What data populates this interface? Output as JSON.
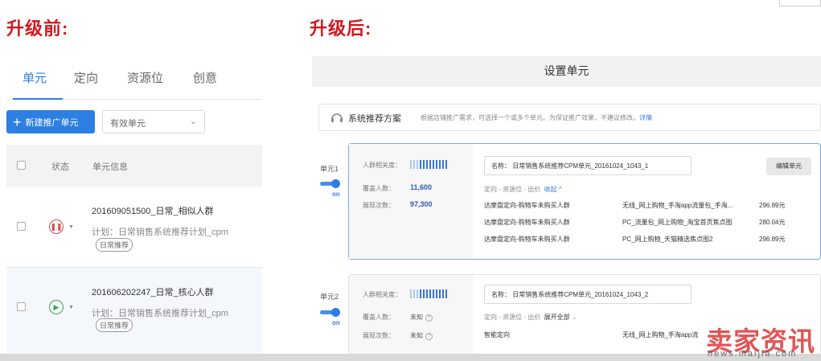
{
  "before": {
    "title": "升级前:",
    "tabs": [
      {
        "label": "单元",
        "active": true
      },
      {
        "label": "定向",
        "active": false
      },
      {
        "label": "资源位",
        "active": false
      },
      {
        "label": "创意",
        "active": false
      }
    ],
    "new_button": {
      "icon": "plus-icon",
      "label": "新建推广单元"
    },
    "filter": {
      "value": "有效单元",
      "icon": "chevron-down-icon"
    },
    "table": {
      "headers": [
        "状态",
        "单元信息"
      ],
      "rows": [
        {
          "status": "paused",
          "status_icon": "pause-icon",
          "name": "201609051500_日常_相似人群",
          "plan": "计划：日常销售系统推荐计划_cpm",
          "tag": "日常推荐"
        },
        {
          "status": "running",
          "status_icon": "play-icon",
          "name": "201606202247_日常_核心人群",
          "plan": "计划：日常销售系统推荐计划_cpm",
          "tag": "日常推荐"
        }
      ]
    }
  },
  "after": {
    "title": "升级后:",
    "header_title": "设置单元",
    "recommend": {
      "icon": "recommend-icon",
      "title": "系统推荐方案",
      "desc": "根据店铺推广需求，可选择一个或多个单元。为保证推广效果，不建议修改。",
      "link": "详情"
    },
    "units": [
      {
        "label": "单元1",
        "toggle": "on",
        "metrics": {
          "relevance_label": "人群相关度：",
          "coverage_label": "覆盖人数：",
          "coverage_value": "11,600",
          "impressions_label": "展现次数：",
          "impressions_value": "97,300"
        },
        "name_label": "名称：",
        "name_value": "日常销售系统推荐CPM单元_20161024_1043_1",
        "edit_label": "编辑单元",
        "sub_label": "定向 - 资源位 - 出价",
        "toggle_link": "收起 ^",
        "rows": [
          {
            "target": "达摩盘定向-购物车未购买人群",
            "resource": "无线_网上购物_手淘app流量包_手淘...",
            "price": "296.89元"
          },
          {
            "target": "达摩盘定向-购物车未购买人群",
            "resource": "PC_流量包_网上购物_淘宝首页焦点图",
            "price": "280.04元"
          },
          {
            "target": "达摩盘定向-购物车未购买人群",
            "resource": "PC_网上购物_天猫精选焦点图2",
            "price": "296.89元"
          }
        ]
      },
      {
        "label": "单元2",
        "toggle": "on",
        "metrics": {
          "relevance_label": "人群相关度：",
          "coverage_label": "覆盖人数：",
          "coverage_value": "未知",
          "impressions_label": "展现次数：",
          "impressions_value": "未知"
        },
        "name_label": "名称：",
        "name_value": "日常销售系统推荐CPM单元_20161024_1043_2",
        "sub_label": "定向 - 资源位 - 出价",
        "toggle_link": "展开全部",
        "rows": [
          {
            "target": "智能定向",
            "resource": "无线_网上购物_手淘app流",
            "price": ""
          }
        ]
      }
    ]
  },
  "watermark": {
    "big": "卖家资讯",
    "small": "news.maijia.com"
  }
}
